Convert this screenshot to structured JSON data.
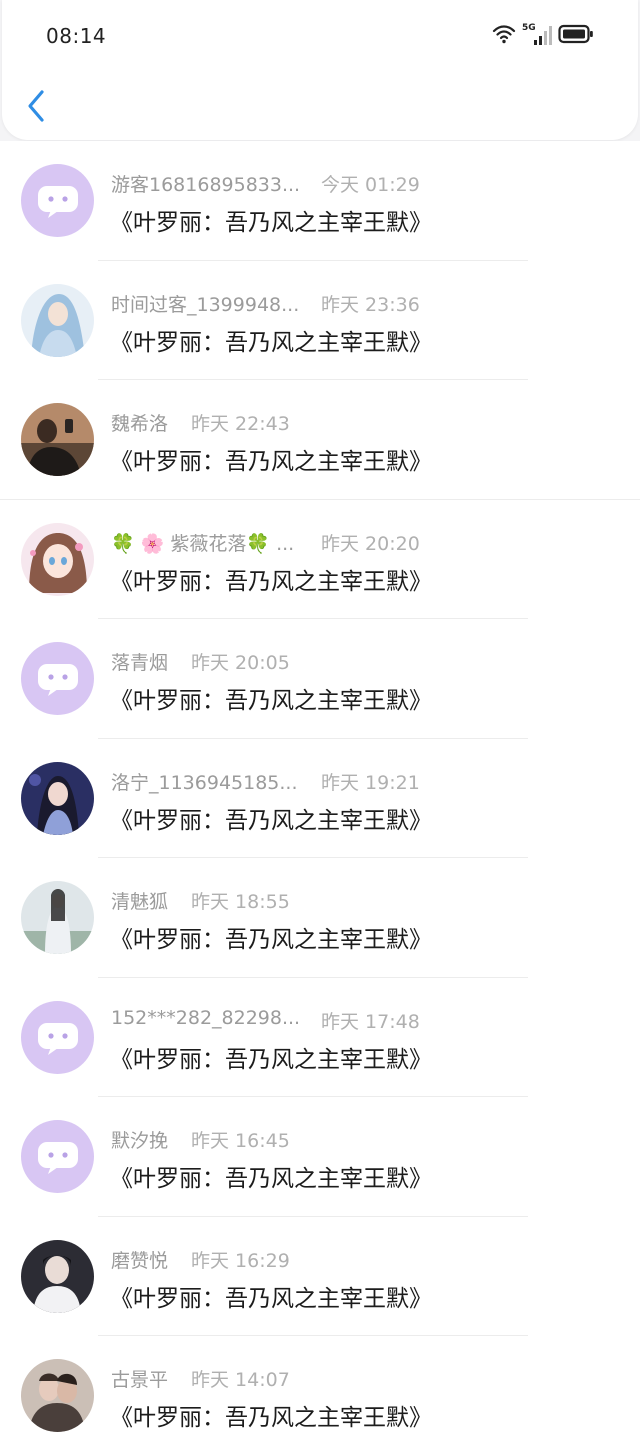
{
  "status_bar": {
    "time": "08:14",
    "network": "5G"
  },
  "colors": {
    "accent": "#2f8de4",
    "default_avatar": "#d8c6f3"
  },
  "messages": [
    {
      "name": "游客16816895833...",
      "time": "今天 01:29",
      "text": "《叶罗丽：吾乃风之主宰王默》",
      "avatar": "default-avatar-icon"
    },
    {
      "name": "时间过客_1399948...",
      "time": "昨天 23:36",
      "text": "《叶罗丽：吾乃风之主宰王默》",
      "avatar": "blue-haired-figure-avatar"
    },
    {
      "name": "魏希洛",
      "time": "昨天 22:43",
      "text": "《叶罗丽：吾乃风之主宰王默》",
      "avatar": "person-photo-avatar"
    },
    {
      "name": "🍀 🌸 紫薇花落🍀 ...",
      "time": "昨天 20:20",
      "text": "《叶罗丽：吾乃风之主宰王默》",
      "avatar": "anime-girl-avatar"
    },
    {
      "name": "落青烟",
      "time": "昨天 20:05",
      "text": "《叶罗丽：吾乃风之主宰王默》",
      "avatar": "default-avatar-icon"
    },
    {
      "name": "洛宁_1136945185...",
      "time": "昨天 19:21",
      "text": "《叶罗丽：吾乃风之主宰王默》",
      "avatar": "costume-girl-avatar"
    },
    {
      "name": "清魅狐",
      "time": "昨天 18:55",
      "text": "《叶罗丽：吾乃风之主宰王默》",
      "avatar": "hanfu-figure-avatar"
    },
    {
      "name": "152***282_82298...",
      "time": "昨天 17:48",
      "text": "《叶罗丽：吾乃风之主宰王默》",
      "avatar": "default-avatar-icon"
    },
    {
      "name": "默汐挽",
      "time": "昨天 16:45",
      "text": "《叶罗丽：吾乃风之主宰王默》",
      "avatar": "default-avatar-icon"
    },
    {
      "name": "磨赞悦",
      "time": "昨天 16:29",
      "text": "《叶罗丽：吾乃风之主宰王默》",
      "avatar": "portrait-avatar"
    },
    {
      "name": "古景平",
      "time": "昨天 14:07",
      "text": "《叶罗丽：吾乃风之主宰王默》",
      "avatar": "couple-photo-avatar"
    }
  ]
}
